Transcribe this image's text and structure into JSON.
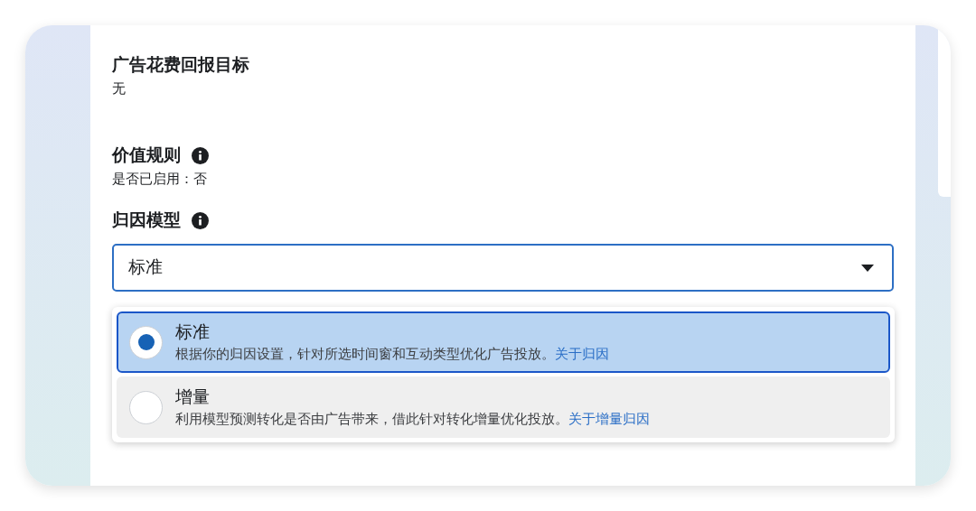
{
  "sections": [
    {
      "title": "广告花费回报目标",
      "info": false,
      "value": "无"
    },
    {
      "title": "价值规则",
      "info": true,
      "value": "是否已启用：否"
    }
  ],
  "attribution": {
    "title": "归因模型",
    "info": true,
    "select_value": "标准",
    "expanded": true,
    "options": [
      {
        "label": "标准",
        "description": "根据你的归因设置，针对所选时间窗和互动类型优化广告投放。",
        "link": "关于归因",
        "selected": true
      },
      {
        "label": "增量",
        "description": "利用模型预测转化是否由广告带来，借此针对转化增量优化投放。",
        "link": "关于增量归因",
        "selected": false
      }
    ]
  }
}
